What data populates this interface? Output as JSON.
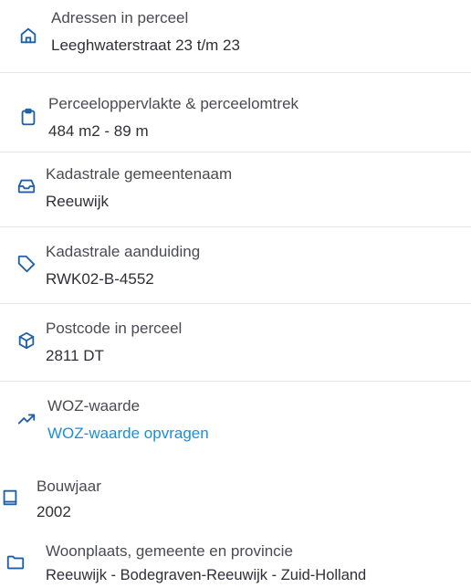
{
  "colors": {
    "icon": "#1d5fa8",
    "link": "#1a8fd6",
    "label": "#4a4a52",
    "value": "#2f2f37",
    "divider": "#e6e6e6"
  },
  "items": [
    {
      "icon": "home-icon",
      "label": "Adressen in perceel",
      "value": "Leeghwaterstraat 23 t/m 23"
    },
    {
      "icon": "clipboard-icon",
      "label": "Perceeloppervlakte & perceelomtrek",
      "value": "484 m2 - 89 m"
    },
    {
      "icon": "inbox-icon",
      "label": "Kadastrale gemeentenaam",
      "value": "Reeuwijk"
    },
    {
      "icon": "tag-icon",
      "label": "Kadastrale aanduiding",
      "value": "RWK02-B-4552"
    },
    {
      "icon": "package-icon",
      "label": "Postcode in perceel",
      "value": "2811 DT"
    },
    {
      "icon": "trending-up-icon",
      "label": "WOZ-waarde",
      "value": "WOZ-waarde opvragen"
    },
    {
      "icon": "book-icon",
      "label": "Bouwjaar",
      "value": "2002"
    },
    {
      "icon": "folder-icon",
      "label": "Woonplaats, gemeente en provincie",
      "value": "Reeuwijk - Bodegraven-Reeuwijk - Zuid-Holland"
    }
  ]
}
